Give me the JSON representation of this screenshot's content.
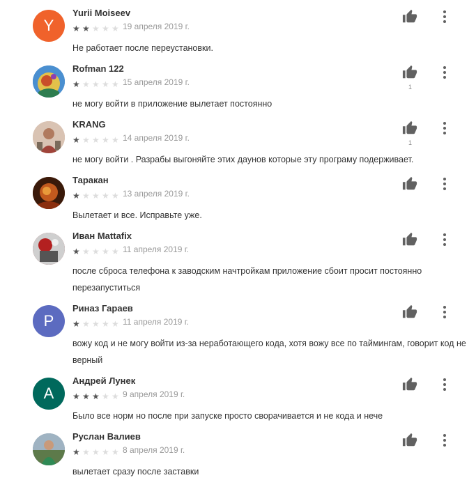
{
  "reviews": [
    {
      "name": "Yurii Moiseev",
      "avatar_letter": "Y",
      "avatar_color": "#f0622b",
      "rating": 2,
      "date": "19 апреля 2019 г.",
      "text": "Не работает после переустановки.",
      "likes": ""
    },
    {
      "name": "Rofman 122",
      "avatar_letter": "",
      "avatar_color": "#3f7fbf",
      "rating": 1,
      "date": "15 апреля 2019 г.",
      "text": "не могу войти в приложение вылетает постоянно",
      "likes": "1"
    },
    {
      "name": "KRANG",
      "avatar_letter": "",
      "avatar_color": "#c8a08a",
      "rating": 1,
      "date": "14 апреля 2019 г.",
      "text": "не могу войти . Разрабы выгоняйте этих даунов которые эту програму подерживает.",
      "likes": "1"
    },
    {
      "name": "Таракан",
      "avatar_letter": "",
      "avatar_color": "#7a3a12",
      "rating": 1,
      "date": "13 апреля 2019 г.",
      "text": "Вылетает и все. Исправьте уже.",
      "likes": ""
    },
    {
      "name": "Иван Mattafix",
      "avatar_letter": "",
      "avatar_color": "#8a2a2a",
      "rating": 1,
      "date": "11 апреля 2019 г.",
      "text": "после сброса телефона к заводским начтройкам приложение сбоит просит постоянно перезапуститься",
      "likes": ""
    },
    {
      "name": "Риназ Гараев",
      "avatar_letter": "P",
      "avatar_color": "#5c6bc0",
      "rating": 1,
      "date": "11 апреля 2019 г.",
      "text": "вожу код и не могу войти из-за неработающего кода, хотя вожу все по таймингам, говорит код не верный",
      "likes": ""
    },
    {
      "name": "Андрей Лунек",
      "avatar_letter": "A",
      "avatar_color": "#00695c",
      "rating": 3,
      "date": "9 апреля 2019 г.",
      "text": "Было все норм но после при запуске просто сворачивается и не кода и нече",
      "likes": ""
    },
    {
      "name": "Руслан Валиев",
      "avatar_letter": "",
      "avatar_color": "#6f8a9a",
      "rating": 1,
      "date": "8 апреля 2019 г.",
      "text": "вылетает сразу после заставки",
      "likes": ""
    }
  ],
  "icons": {
    "thumb": "thumb-up-icon",
    "more": "more-vert-icon",
    "star": "star-icon"
  },
  "colors": {
    "star_on": "#555555",
    "star_off": "#dddddd",
    "icon": "#616161"
  }
}
